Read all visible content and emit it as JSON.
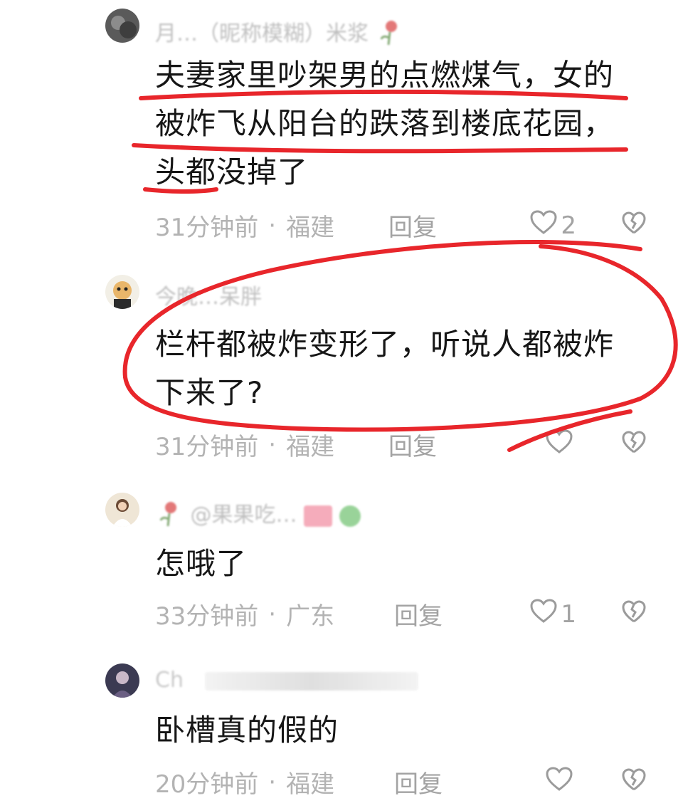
{
  "comments": [
    {
      "username": "月…（昵称模糊）米浆",
      "text": "夫妻家里吵架男的点燃煤气，女的被炸飞从阳台的跌落到楼底花园，头都没掉了",
      "time": "31分钟前",
      "location": "福建",
      "reply": "回复",
      "likes": "2"
    },
    {
      "username": "今晚…呆胖",
      "text": "栏杆都被炸变形了，听说人都被炸下来了?",
      "time": "31分钟前",
      "location": "福建",
      "reply": "回复",
      "likes": ""
    },
    {
      "username": "@果果吃…",
      "text": "怎哦了",
      "time": "33分钟前",
      "location": "广东",
      "reply": "回复",
      "likes": "1"
    },
    {
      "username": "Ch",
      "text": "卧槽真的假的",
      "time": "20分钟前",
      "location": "福建",
      "reply": "回复",
      "likes": ""
    }
  ],
  "icons": {
    "like": "heart-outline-icon",
    "dislike": "broken-heart-icon",
    "flower": "rose-icon"
  },
  "colors": {
    "annotation": "#e8262b",
    "meta": "#b3b3b3"
  }
}
